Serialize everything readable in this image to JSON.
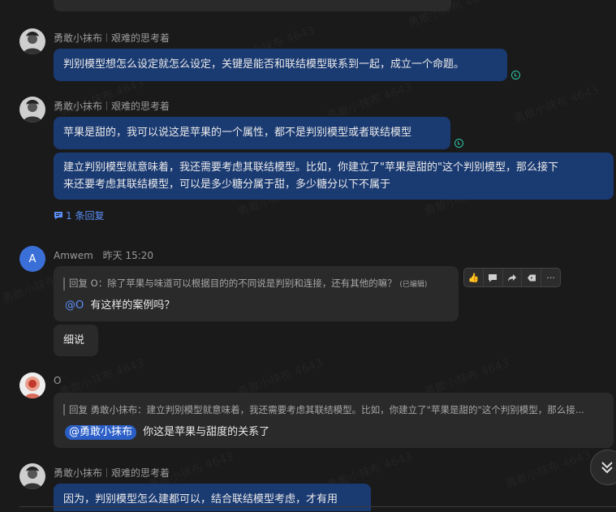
{
  "watermark": "勇敢小抹布 4643",
  "messages": {
    "m1": {
      "author": "勇敢小抹布",
      "status": "艰难的思考着",
      "text": "判别模型想怎么设定就怎么设定，关键是能否和联结模型联系到一起，成立一个命题。"
    },
    "m2": {
      "author": "勇敢小抹布",
      "status": "艰难的思考着",
      "text1": "苹果是甜的，我可以说这是苹果的一个属性，都不是判别模型或者联结模型",
      "text2_line1": "建立判别模型就意味着，我还需要考虑其联结模型。比如，你建立了\"苹果是甜的\"这个判别模型，那么接下",
      "text2_line2": "来还要考虑其联结模型，可以是多少糖分属于甜，多少糖分以下不属于",
      "replies": "1 条回复"
    },
    "m3": {
      "avatar_letter": "A",
      "author": "Amwem",
      "time": "昨天 15:20",
      "quote": "回复 O：除了苹果与味道可以根据目的的不同说是判别和连接，还有其他的嘛？",
      "edited": "(已编辑)",
      "mention": "@O",
      "text": "有这样的案例吗？",
      "text2": "细说"
    },
    "m4": {
      "author": "O",
      "quote": "回复 勇敢小抹布：建立判别模型就意味着，我还需要考虑其联结模型。比如，你建立了\"苹果是甜的\"这个判别模型，那么接...",
      "mention": "@勇敢小抹布",
      "text": "你这是苹果与甜度的关系了"
    },
    "m5": {
      "author": "勇敢小抹布",
      "status": "艰难的思考着",
      "text": "因为，判别模型怎么建都可以，结合联结模型考虑，才有用"
    }
  }
}
